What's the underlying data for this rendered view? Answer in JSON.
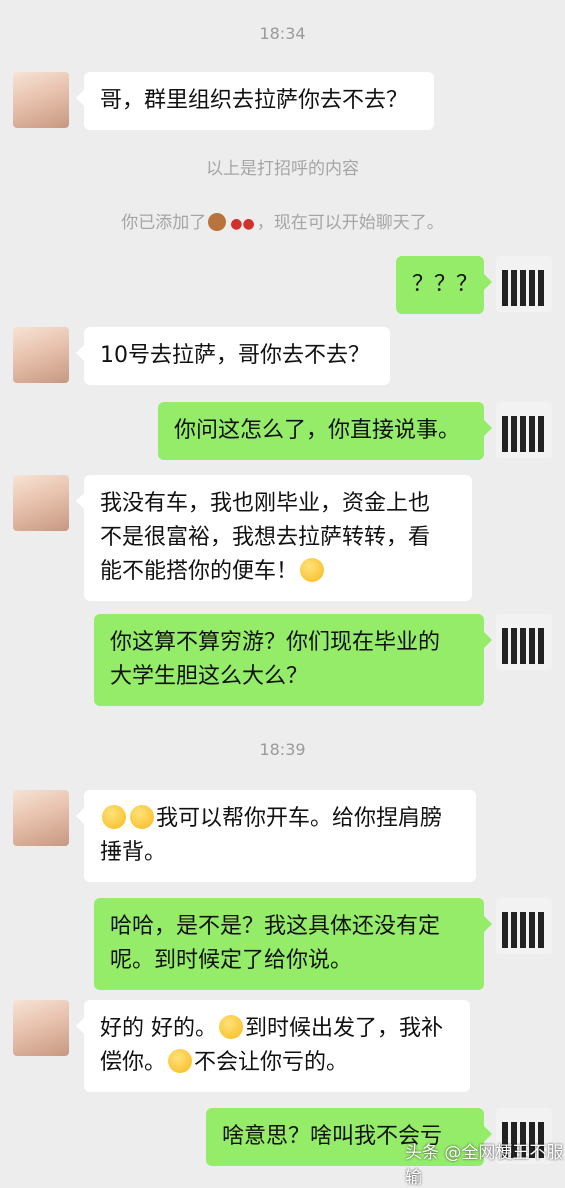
{
  "timestamps": [
    "18:34",
    "18:39"
  ],
  "system_messages": {
    "greeting_note": "以上是打招呼的内容",
    "added_prefix": "你已添加了",
    "added_suffix": "，现在可以开始聊天了。"
  },
  "icons": {
    "bear": "bear-emoji",
    "paws": "paw-prints-emoji",
    "teary": "teary-face-emoji",
    "blush": "smiling-face-emoji",
    "heart_eyes": "heart-eyes-emoji"
  },
  "messages": [
    {
      "side": "left",
      "text": "哥，群里组织去拉萨你去不去？"
    },
    {
      "side": "right",
      "text": "？？？"
    },
    {
      "side": "left",
      "text": "10号去拉萨，哥你去不去？"
    },
    {
      "side": "right",
      "text": "你问这怎么了，你直接说事。"
    },
    {
      "side": "left",
      "text_a": "我没有车，我也刚毕业，资金上也",
      "text_b": "不是很富裕，我想去拉萨转转，看",
      "text_c": "能不能搭你的便车！"
    },
    {
      "side": "right",
      "text_a": "你这算不算穷游？你们现在毕业的",
      "text_b": "大学生胆这么大么？"
    },
    {
      "side": "left",
      "text_a": "我可以帮你开车。给你捏肩膀",
      "text_b": "捶背。"
    },
    {
      "side": "right",
      "text_a": "哈哈，是不是？我这具体还没有定",
      "text_b": "呢。到时候定了给你说。"
    },
    {
      "side": "left",
      "text_a": "好的 好的。",
      "text_b": "到时候出发了，我补",
      "text_c": "偿你。",
      "text_d": "不会让你亏的。"
    },
    {
      "side": "right",
      "text": "啥意思？啥叫我不会亏"
    }
  ],
  "watermark": "头条 @全网梗王不服输",
  "colors": {
    "background": "#ededed",
    "self_bubble": "#95ec69",
    "other_bubble": "#ffffff"
  }
}
